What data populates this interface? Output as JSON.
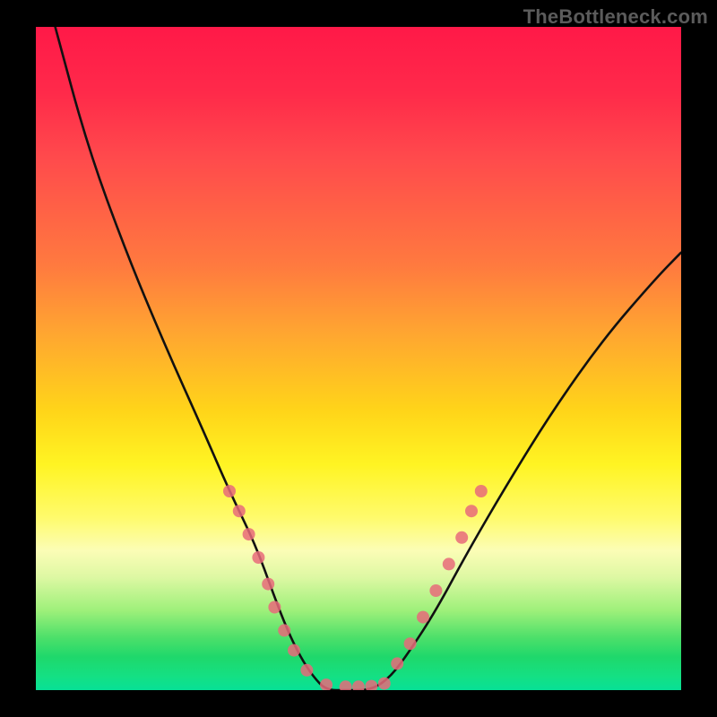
{
  "watermark": "TheBottleneck.com",
  "chart_data": {
    "type": "line",
    "title": "",
    "xlabel": "",
    "ylabel": "",
    "xlim": [
      0,
      100
    ],
    "ylim": [
      0,
      100
    ],
    "series": [
      {
        "name": "curve",
        "x": [
          3,
          8,
          14,
          20,
          26,
          30,
          34,
          37,
          39,
          41,
          43,
          45,
          48,
          52,
          55,
          58,
          62,
          67,
          73,
          80,
          88,
          96,
          100
        ],
        "y": [
          100,
          82,
          66,
          52,
          39,
          30,
          22,
          14,
          9,
          5,
          2,
          0,
          0,
          0,
          2,
          6,
          12,
          21,
          31,
          42,
          53,
          62,
          66
        ]
      }
    ],
    "markers": {
      "name": "dots",
      "color": "#e86a7a",
      "points": [
        {
          "x": 30,
          "y": 30
        },
        {
          "x": 31.5,
          "y": 27
        },
        {
          "x": 33,
          "y": 23.5
        },
        {
          "x": 34.5,
          "y": 20
        },
        {
          "x": 36,
          "y": 16
        },
        {
          "x": 37,
          "y": 12.5
        },
        {
          "x": 38.5,
          "y": 9
        },
        {
          "x": 40,
          "y": 6
        },
        {
          "x": 42,
          "y": 3
        },
        {
          "x": 45,
          "y": 0.8
        },
        {
          "x": 48,
          "y": 0.5
        },
        {
          "x": 50,
          "y": 0.5
        },
        {
          "x": 52,
          "y": 0.6
        },
        {
          "x": 54,
          "y": 1
        },
        {
          "x": 56,
          "y": 4
        },
        {
          "x": 58,
          "y": 7
        },
        {
          "x": 60,
          "y": 11
        },
        {
          "x": 62,
          "y": 15
        },
        {
          "x": 64,
          "y": 19
        },
        {
          "x": 66,
          "y": 23
        },
        {
          "x": 67.5,
          "y": 27
        },
        {
          "x": 69,
          "y": 30
        }
      ]
    },
    "background_gradient": {
      "top": "#ff1948",
      "mid_upper": "#ffa531",
      "mid": "#fff423",
      "mid_lower": "#9ef07a",
      "bottom": "#07e096"
    }
  }
}
